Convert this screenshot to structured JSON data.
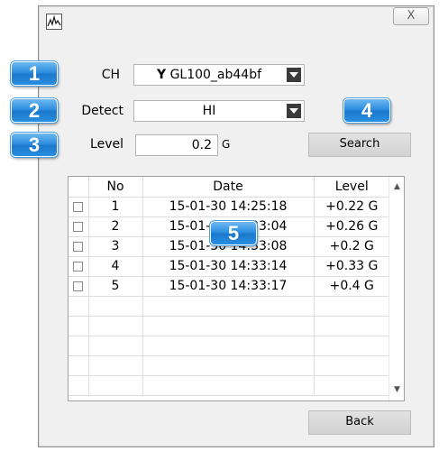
{
  "dialog": {
    "close_label": "X"
  },
  "form": {
    "ch_label": "CH",
    "ch_symbol": "Y",
    "ch_value": "GL100_ab44bf",
    "detect_label": "Detect",
    "detect_value": "HI",
    "level_label": "Level",
    "level_value": "0.2",
    "level_unit": "G",
    "search_button": "Search"
  },
  "table": {
    "headers": [
      "No",
      "Date",
      "Level"
    ],
    "rows": [
      {
        "no": "1",
        "date": "15-01-30 14:25:18",
        "level": "+0.22 G"
      },
      {
        "no": "2",
        "date": "15-01-30 14:33:04",
        "level": "+0.26 G"
      },
      {
        "no": "3",
        "date": "15-01-30 14:33:08",
        "level": "+0.2 G"
      },
      {
        "no": "4",
        "date": "15-01-30 14:33:14",
        "level": "+0.33 G"
      },
      {
        "no": "5",
        "date": "15-01-30 14:33:17",
        "level": "+0.4 G"
      }
    ],
    "scroll_up": "▲",
    "scroll_down": "▼"
  },
  "back_button": "Back",
  "badges": [
    "1",
    "2",
    "3",
    "4",
    "5"
  ]
}
